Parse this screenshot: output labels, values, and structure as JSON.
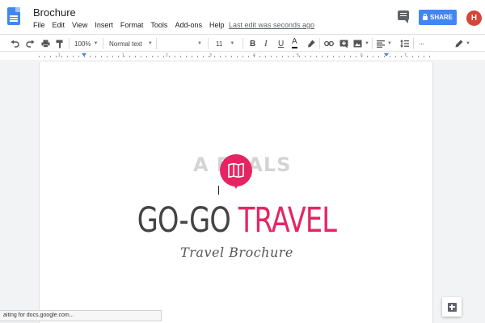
{
  "app": {
    "doc_title": "Brochure",
    "last_edit": "Last edit was seconds ago",
    "share_label": "SHARE",
    "avatar_initial": "H",
    "accent_color": "#4285f4"
  },
  "menu": [
    "File",
    "Edit",
    "View",
    "Insert",
    "Format",
    "Tools",
    "Add-ons",
    "Help"
  ],
  "toolbar": {
    "zoom": "100%",
    "style": "Normal text",
    "font_size": "11",
    "bold": "B",
    "italic": "I",
    "underline": "U",
    "text_color": "A",
    "more": "···"
  },
  "ruler": {
    "numbers": [
      "1",
      "1",
      "2",
      "3",
      "4",
      "5",
      "6",
      "7"
    ]
  },
  "document": {
    "headline_part1": "GO-GO ",
    "headline_part2": "TRAVEL",
    "subtitle": "Travel Brochure",
    "headline_dark_color": "#444444",
    "headline_accent_color": "#e52563"
  },
  "watermark": "A  PUALS",
  "status_bar": "aiting for docs.google.com..."
}
